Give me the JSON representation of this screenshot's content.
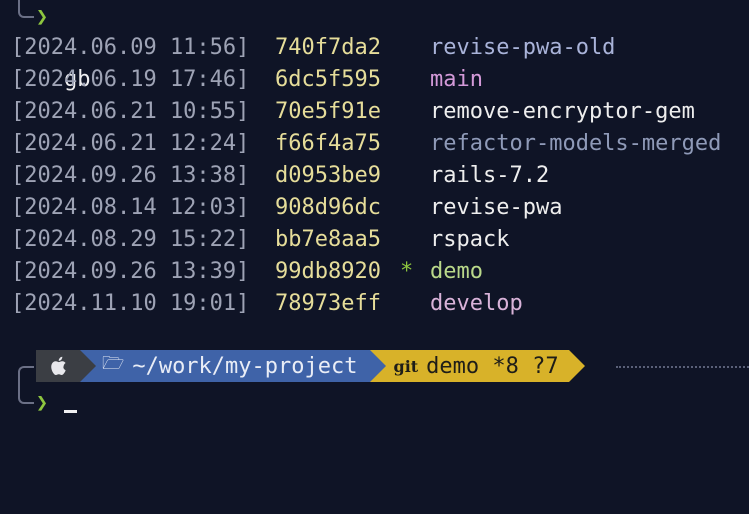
{
  "command": {
    "prompt_symbol": "❯",
    "text": "gb"
  },
  "branches": [
    {
      "date": "[2024.06.09 11:56]",
      "hash": "740f7da2",
      "current": "",
      "name": "revise-pwa-old",
      "color": "#a9b3d9"
    },
    {
      "date": "[2024.06.19 17:46]",
      "hash": "6dc5f595",
      "current": "",
      "name": "main",
      "color": "#d49ad9"
    },
    {
      "date": "[2024.06.21 10:55]",
      "hash": "70e5f91e",
      "current": "",
      "name": "remove-encryptor-gem",
      "color": "#eeeeee"
    },
    {
      "date": "[2024.06.21 12:24]",
      "hash": "f66f4a75",
      "current": "",
      "name": "refactor-models-merged",
      "color": "#8f9ab8"
    },
    {
      "date": "[2024.09.26 13:38]",
      "hash": "d0953be9",
      "current": "",
      "name": "rails-7.2",
      "color": "#eeeeee"
    },
    {
      "date": "[2024.08.14 12:03]",
      "hash": "908d96dc",
      "current": "",
      "name": "revise-pwa",
      "color": "#eeeeee"
    },
    {
      "date": "[2024.08.29 15:22]",
      "hash": "bb7e8aa5",
      "current": "",
      "name": "rspack",
      "color": "#eeeeee"
    },
    {
      "date": "[2024.09.26 13:39]",
      "hash": "99db8920",
      "current": "*",
      "name": "demo",
      "color": "#b9d88a"
    },
    {
      "date": "[2024.11.10 19:01]",
      "hash": "78973eff",
      "current": "",
      "name": "develop",
      "color": "#d9b3d9"
    }
  ],
  "prompt_bar": {
    "os_icon": "apple-logo-icon",
    "folder_icon": "folder-open-icon",
    "path": "~/work/my-project",
    "git_icon": "git",
    "git_status": "demo *8 ?7"
  },
  "input": {
    "prompt_symbol": "❯",
    "value": ""
  }
}
